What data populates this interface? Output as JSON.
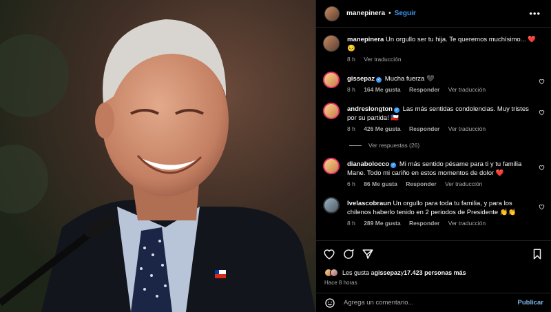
{
  "header": {
    "username": "manepinera",
    "separator": "•",
    "follow_label": "Seguir",
    "more_label": "•••"
  },
  "caption": {
    "username": "manepinera",
    "text": "Un orgullo ser tu hija. Te queremos muchísimo... ❤️",
    "text2": "😔",
    "time": "8 h",
    "translate": "Ver traducción"
  },
  "comments": [
    {
      "username": "gissepaz",
      "verified": true,
      "text": "Mucha fuerza 🖤",
      "time": "8 h",
      "likes": "164 Me gusta",
      "reply": "Responder",
      "translate": "Ver traducción"
    },
    {
      "username": "andreslongton",
      "verified": true,
      "text": "Las más sentidas condolencias. Muy tristes por su partida! 🇨🇱",
      "time": "8 h",
      "likes": "426 Me gusta",
      "reply": "Responder",
      "translate": "Ver traducción",
      "replies": "Ver respuestas (26)"
    },
    {
      "username": "dianabolocco",
      "verified": true,
      "text": "Mi más sentido pésame para ti y tu familia Mane. Todo mi cariño en estos momentos de dolor ❤️",
      "time": "6 h",
      "likes": "86 Me gusta",
      "reply": "Responder",
      "translate": "Ver traducción"
    },
    {
      "username": "lvelascobraun",
      "verified": false,
      "text": "Un orgullo para toda tu familia, y para los chilenos haberlo tenido en 2 periodos de Presidente 👏👏",
      "time": "8 h",
      "likes": "289 Me gusta",
      "reply": "Responder",
      "translate": "Ver traducción"
    }
  ],
  "likes": {
    "prefix": "Les gusta a ",
    "user": "gissepaz",
    "middle": " y ",
    "count": "17.423 personas más"
  },
  "posted": "Hace 8 horas",
  "composer": {
    "placeholder": "Agrega un comentario...",
    "post_label": "Publicar"
  },
  "icons": {
    "like": "heart-icon",
    "comment": "comment-icon",
    "share": "share-icon",
    "save": "bookmark-icon",
    "emoji": "emoji-icon",
    "more": "more-icon"
  },
  "colors": {
    "accent": "#3b9cf6",
    "background": "#000000",
    "muted": "#a8a8a8"
  }
}
